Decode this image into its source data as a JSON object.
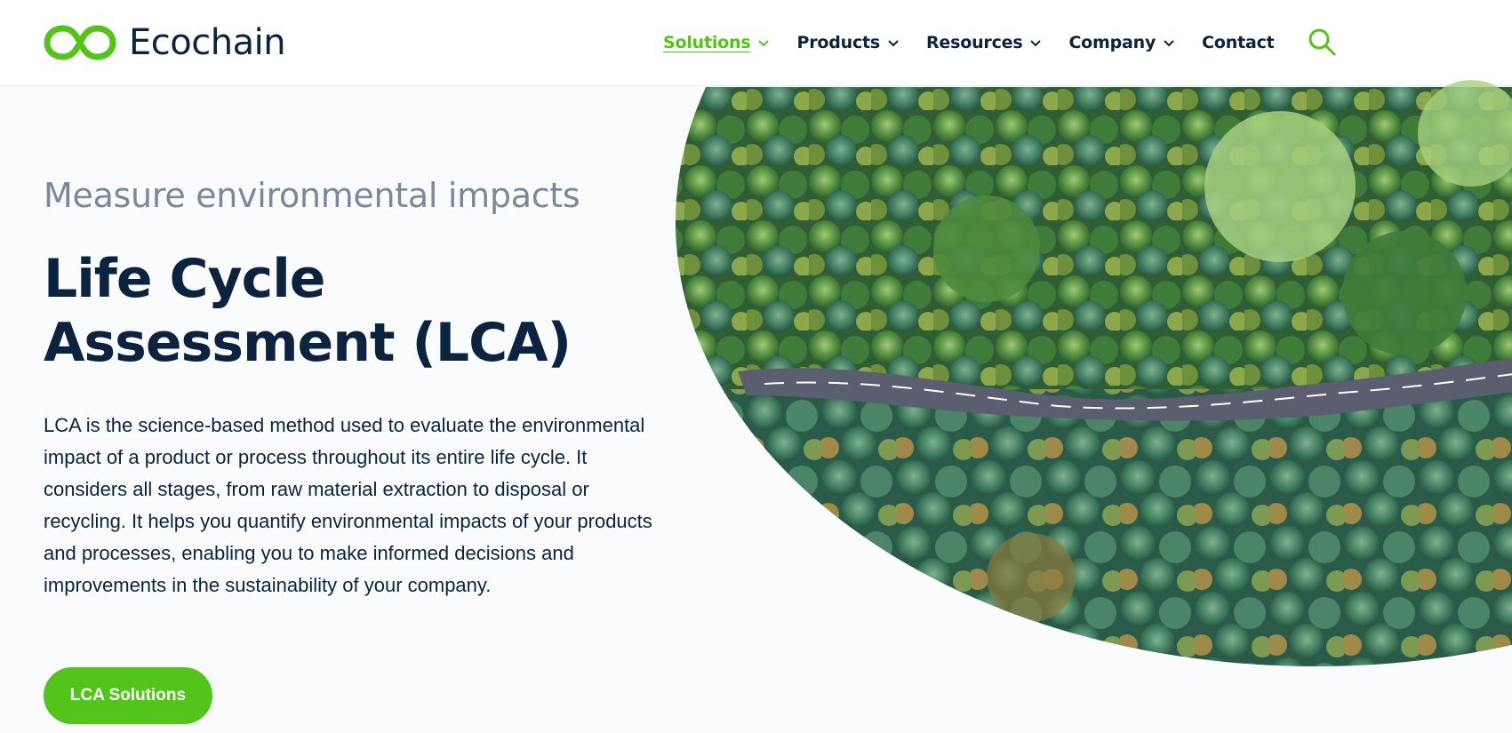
{
  "brand": {
    "name": "Ecochain",
    "accent_color": "#52c41a",
    "text_color": "#0c2340"
  },
  "nav": {
    "items": [
      {
        "label": "Solutions",
        "has_dropdown": true,
        "active": true
      },
      {
        "label": "Products",
        "has_dropdown": true,
        "active": false
      },
      {
        "label": "Resources",
        "has_dropdown": true,
        "active": false
      },
      {
        "label": "Company",
        "has_dropdown": true,
        "active": false
      },
      {
        "label": "Contact",
        "has_dropdown": false,
        "active": false
      }
    ],
    "search_icon": "search-icon"
  },
  "hero": {
    "subtitle": "Measure environmental impacts",
    "title": "Life Cycle Assessment (LCA)",
    "description": "LCA is the science-based method used to evaluate the environmental impact of a product or process throughout its entire life cycle. It considers all stages, from raw material extraction to disposal or recycling. It helps you quantify environmental impacts of your products and processes, enabling you to make informed decisions and improvements in the sustainability of your company.",
    "cta_label": "LCA Solutions",
    "image": "aerial-forest-road-image"
  }
}
